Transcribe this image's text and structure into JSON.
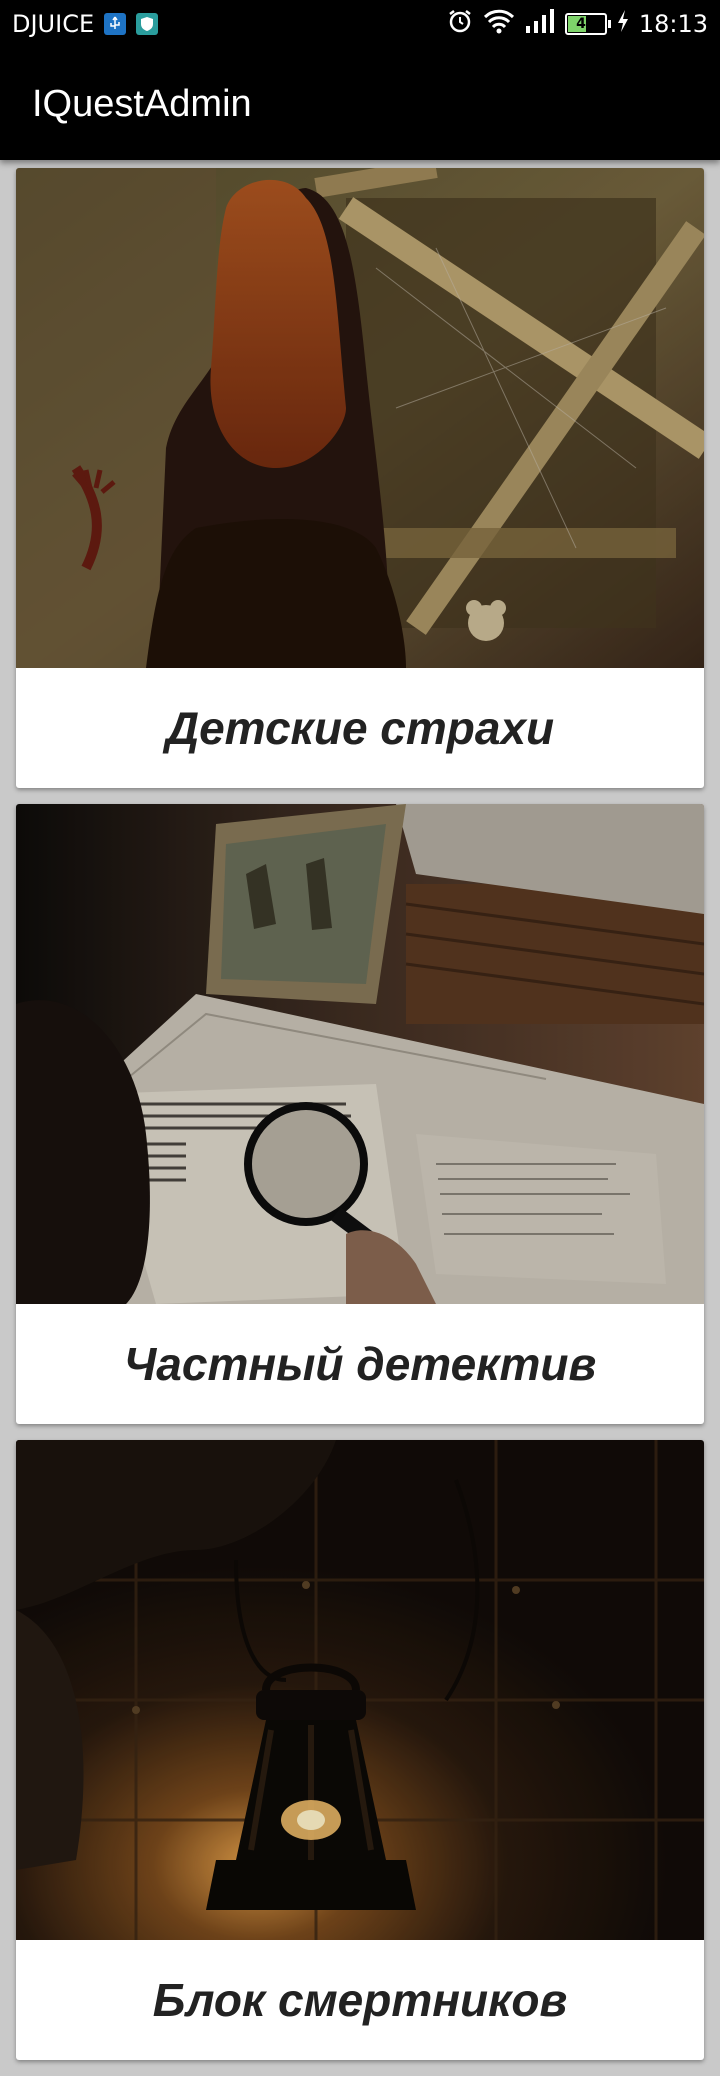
{
  "status_bar": {
    "carrier": "DJUICE",
    "battery": "48",
    "time": "18:13",
    "icons": [
      "usb-icon",
      "shield-icon",
      "alarm-icon",
      "wifi-icon",
      "signal-icon",
      "battery-icon",
      "charging-icon"
    ]
  },
  "app_bar": {
    "title": "IQuestAdmin"
  },
  "quests": [
    {
      "title": "Детские страхи",
      "image": "girl-at-boarded-window"
    },
    {
      "title": "Частный детектив",
      "image": "magnifier-over-newspaper"
    },
    {
      "title": "Блок смертников",
      "image": "hand-holding-lantern"
    }
  ]
}
